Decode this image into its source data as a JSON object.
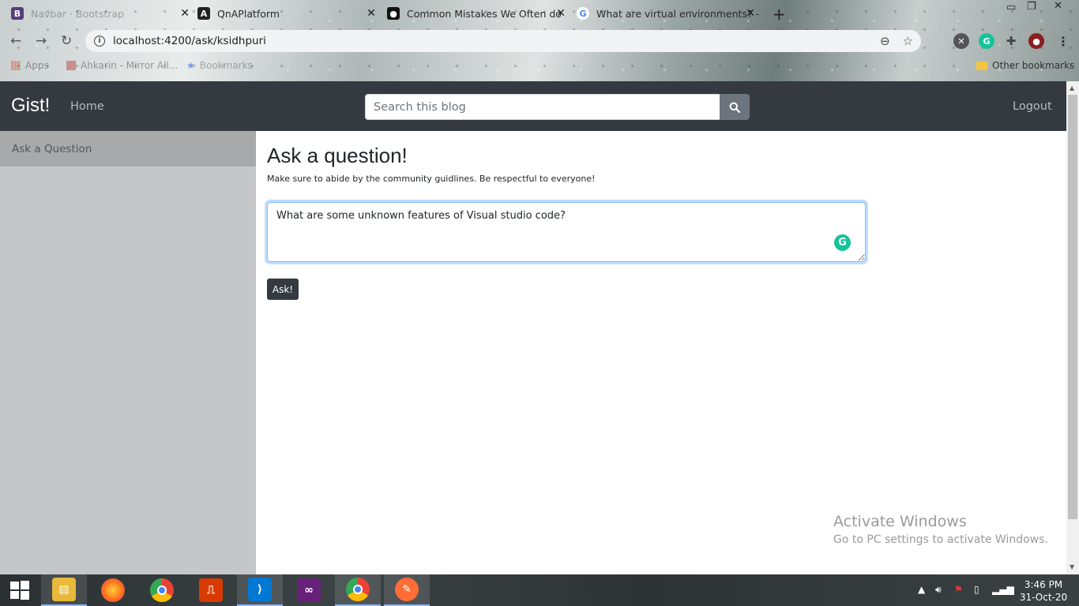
{
  "browser": {
    "tabs": [
      {
        "title": "Navbar · Bootstrap",
        "favicon": "B",
        "favicon_color": "#563d7c"
      },
      {
        "title": "QnAPlatform",
        "favicon": "A",
        "favicon_color": "#222222"
      },
      {
        "title": "Common Mistakes We Often do",
        "favicon": "M",
        "favicon_color": "#111111"
      },
      {
        "title": "What are virtual environments? -",
        "favicon": "G",
        "favicon_color": "#4285f4"
      }
    ],
    "url": "localhost:4200/ask/ksidhpuri",
    "bookmarks": {
      "apps": "Apps",
      "item1": "Ahkarin - Mirror All...",
      "item2": "Bookmarks",
      "other": "Other bookmarks"
    }
  },
  "navbar": {
    "brand": "Gist!",
    "home": "Home",
    "search_placeholder": "Search this blog",
    "logout": "Logout"
  },
  "sidebar": {
    "items": [
      {
        "label": "Ask a Question"
      }
    ]
  },
  "main": {
    "title": "Ask a question!",
    "subtitle": "Make sure to abide by the community guidlines. Be respectful to everyone!",
    "question_value": "What are some unknown features of Visual studio code?",
    "ask_label": "Ask!"
  },
  "watermark": {
    "line1": "Activate Windows",
    "line2": "Go to PC settings to activate Windows."
  },
  "taskbar": {
    "time": "3:46 PM",
    "date": "31-Oct-20",
    "apps": [
      "start-icon",
      "file-explorer-icon",
      "firefox-icon",
      "chrome-icon",
      "office-icon",
      "vscode-icon",
      "visual-studio-icon",
      "chrome-active-icon",
      "postman-icon"
    ]
  },
  "colors": {
    "navbar_bg": "#343a40",
    "sidebar_bg": "#c5c6c8",
    "sidebar_active": "#a8a9ab",
    "focus_border": "#80bdff",
    "grammarly": "#15c39a"
  }
}
